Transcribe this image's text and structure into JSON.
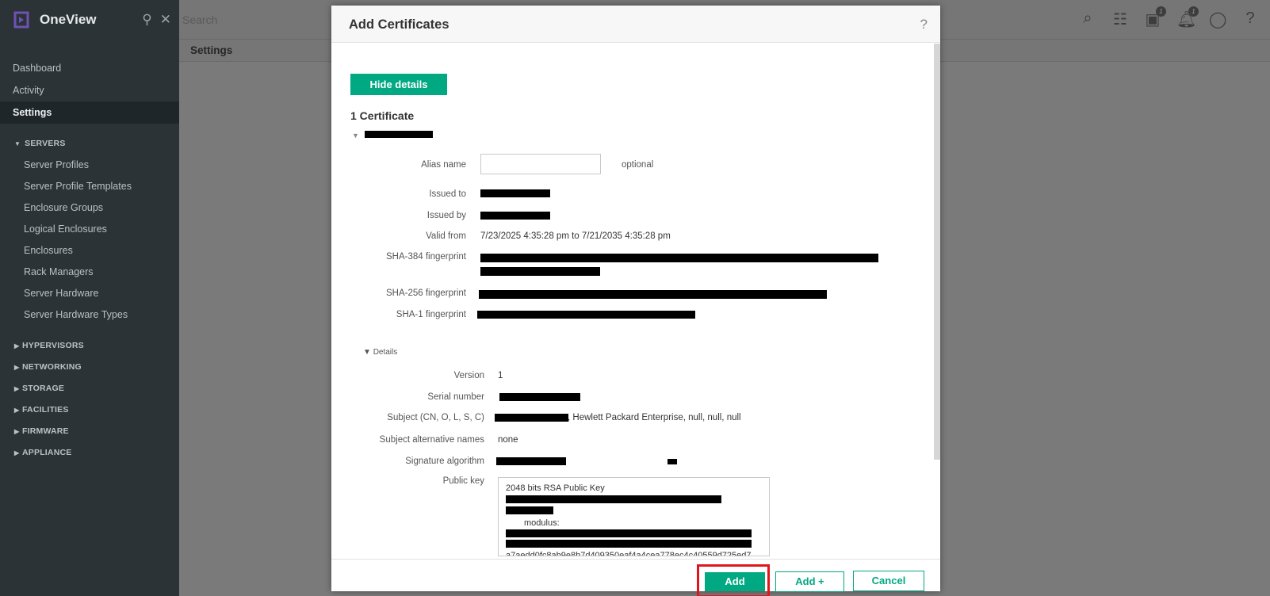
{
  "app": {
    "name": "OneView"
  },
  "header": {
    "search_placeholder": "Search",
    "page_title": "Settings",
    "activity_badge": "1",
    "notifications_badge": "1"
  },
  "sidebar": {
    "top_items": [
      {
        "label": "Dashboard"
      },
      {
        "label": "Activity"
      },
      {
        "label": "Settings",
        "active": true
      }
    ],
    "servers": {
      "label": "SERVERS",
      "items": [
        {
          "label": "Server Profiles"
        },
        {
          "label": "Server Profile Templates"
        },
        {
          "label": "Enclosure Groups"
        },
        {
          "label": "Logical Enclosures"
        },
        {
          "label": "Enclosures"
        },
        {
          "label": "Rack Managers"
        },
        {
          "label": "Server Hardware"
        },
        {
          "label": "Server Hardware Types"
        }
      ]
    },
    "collapsed_sections": [
      {
        "label": "HYPERVISORS"
      },
      {
        "label": "NETWORKING"
      },
      {
        "label": "STORAGE"
      },
      {
        "label": "FACILITIES"
      },
      {
        "label": "FIRMWARE"
      },
      {
        "label": "APPLIANCE"
      }
    ]
  },
  "modal": {
    "title": "Add Certificates",
    "help": "?",
    "hide_details_label": "Hide details",
    "cert_count": "1 Certificate",
    "fields": {
      "alias_label": "Alias name",
      "alias_value": "",
      "alias_hint": "optional",
      "issued_to_label": "Issued to",
      "issued_by_label": "Issued by",
      "valid_from_label": "Valid from",
      "valid_from_value": "7/23/2025 4:35:28 pm to 7/21/2035 4:35:28 pm",
      "sha384_label": "SHA-384 fingerprint",
      "sha256_label": "SHA-256 fingerprint",
      "sha1_label": "SHA-1 fingerprint"
    },
    "details": {
      "toggle_label": "Details",
      "version_label": "Version",
      "version_value": "1",
      "serial_label": "Serial number",
      "subject_label": "Subject (CN, O, L, S, C)",
      "subject_value": ", Hewlett Packard Enterprise, null, null, null",
      "san_label": "Subject alternative names",
      "san_value": "none",
      "sigalg_label": "Signature algorithm",
      "pubkey_label": "Public key",
      "pubkey_line1": "2048 bits RSA Public Key",
      "pubkey_modulus": "modulus:",
      "pubkey_tail": "a7aedd0fc8ab9e8b7d409350eaf4a4cea778ec4c40559d725ed7"
    },
    "footer": {
      "add_label": "Add",
      "add_plus_label": "Add +",
      "cancel_label": "Cancel"
    }
  },
  "colors": {
    "accent": "#01a982",
    "highlight": "#e0161d",
    "sidebar_bg": "#2b3337"
  }
}
